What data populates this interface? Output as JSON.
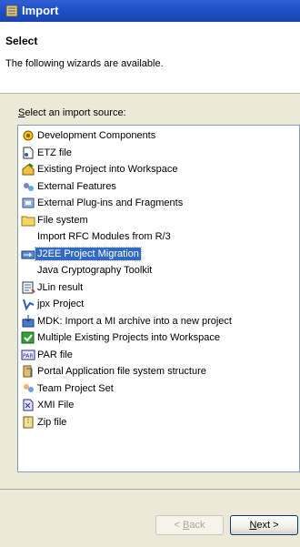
{
  "window": {
    "title": "Import"
  },
  "header": {
    "title": "Select",
    "description": "The following wizards are available."
  },
  "source_label": {
    "accel": "S",
    "rest": "elect an import source:"
  },
  "items": [
    {
      "label": "Development Components",
      "icon": "development-components-icon"
    },
    {
      "label": "ETZ file",
      "icon": "etz-file-icon"
    },
    {
      "label": "Existing Project into Workspace",
      "icon": "existing-project-icon"
    },
    {
      "label": "External Features",
      "icon": "external-features-icon"
    },
    {
      "label": "External Plug-ins and Fragments",
      "icon": "plugins-icon"
    },
    {
      "label": "File system",
      "icon": "folder-icon"
    },
    {
      "label": "Import RFC Modules from R/3",
      "icon": ""
    },
    {
      "label": "J2EE Project Migration",
      "icon": "j2ee-migration-icon",
      "selected": true
    },
    {
      "label": "Java Cryptography Toolkit",
      "icon": ""
    },
    {
      "label": "JLin result",
      "icon": "jlin-result-icon"
    },
    {
      "label": "jpx Project",
      "icon": "jpx-project-icon"
    },
    {
      "label": "MDK: Import a MI archive into a new project",
      "icon": "mdk-archive-icon"
    },
    {
      "label": "Multiple Existing Projects into Workspace",
      "icon": "multiple-projects-icon"
    },
    {
      "label": "PAR file",
      "icon": "par-file-icon"
    },
    {
      "label": "Portal Application file system structure",
      "icon": "portal-app-icon"
    },
    {
      "label": "Team Project Set",
      "icon": "team-project-set-icon"
    },
    {
      "label": "XMI File",
      "icon": "xmi-file-icon"
    },
    {
      "label": "Zip file",
      "icon": "zip-file-icon"
    }
  ],
  "buttons": {
    "back": {
      "accel": "B",
      "pre": "< ",
      "rest": "ack",
      "enabled": false
    },
    "next": {
      "accel": "N",
      "rest": "ext >",
      "enabled": true
    }
  }
}
